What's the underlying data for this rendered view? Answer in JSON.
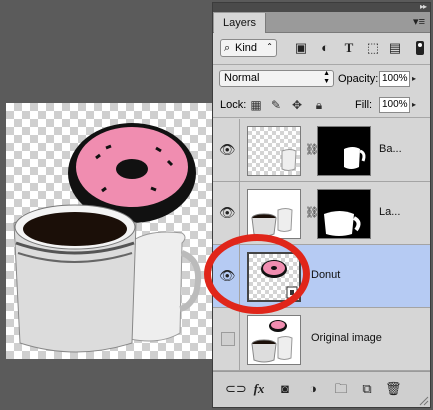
{
  "panel": {
    "tab_label": "Layers",
    "filter": {
      "kind_label": "Kind"
    },
    "blend_mode": "Normal",
    "opacity_label": "Opacity:",
    "opacity_value": "100%",
    "lock_label": "Lock:",
    "fill_label": "Fill:",
    "fill_value": "100%"
  },
  "layers": [
    {
      "name": "Ba...",
      "visible": true,
      "selected": false
    },
    {
      "name": "La...",
      "visible": true,
      "selected": false
    },
    {
      "name": "Donut",
      "visible": true,
      "selected": true
    },
    {
      "name": "Original image",
      "visible": false,
      "selected": false
    }
  ],
  "colors": {
    "selection": "#b6cbf3",
    "annotation_circle": "#e0261a",
    "donut_pink": "#f08db0"
  }
}
